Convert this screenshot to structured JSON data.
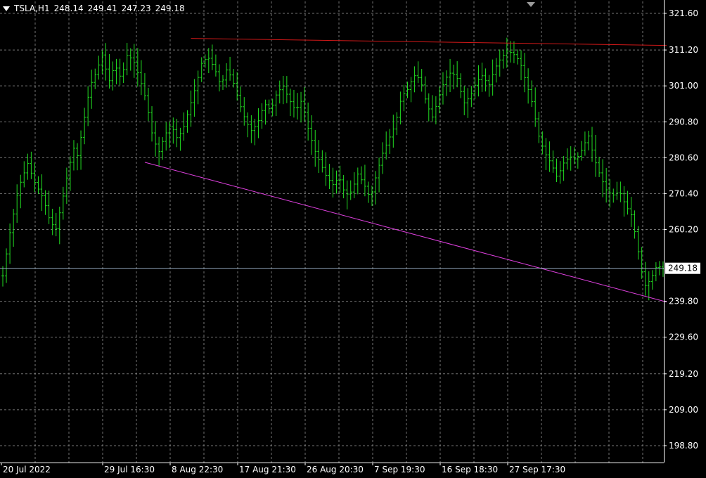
{
  "header": {
    "symbol": "TSLA,H1",
    "open": "248.14",
    "high": "249.41",
    "low": "247.23",
    "close": "249.18"
  },
  "colors": {
    "background": "#000000",
    "grid": "#9a9a9a",
    "bars": "#22dd22",
    "resistance": "#d01818",
    "support": "#e040e0",
    "bid_line": "#8fa3b8"
  },
  "chart_data": {
    "type": "ohlc",
    "symbol": "TSLA",
    "timeframe": "H1",
    "grid": true,
    "ylim": [
      194.0,
      325.0
    ],
    "y_ticks": [
      "321.60",
      "311.20",
      "301.00",
      "290.80",
      "280.60",
      "270.40",
      "260.20",
      "249.18",
      "239.80",
      "229.60",
      "219.20",
      "209.00",
      "198.80"
    ],
    "current_price": 249.18,
    "x_tick_labels": [
      "20 Jul 2022",
      "29 Jul 16:30",
      "8 Aug 22:30",
      "17 Aug 21:30",
      "26 Aug 20:30",
      "7 Sep 19:30",
      "16 Sep 18:30",
      "27 Sep 17:30"
    ],
    "bars_count": 187,
    "close_path": [
      [
        0,
        247
      ],
      [
        2,
        258
      ],
      [
        5,
        272
      ],
      [
        8,
        279
      ],
      [
        10,
        274
      ],
      [
        13,
        269
      ],
      [
        15,
        263
      ],
      [
        17,
        260
      ],
      [
        19,
        268
      ],
      [
        21,
        277
      ],
      [
        23,
        284
      ],
      [
        24,
        281
      ],
      [
        26,
        291
      ],
      [
        28,
        301
      ],
      [
        30,
        305
      ],
      [
        32,
        310
      ],
      [
        34,
        302
      ],
      [
        36,
        307
      ],
      [
        38,
        303
      ],
      [
        40,
        310
      ],
      [
        42,
        308
      ],
      [
        44,
        303
      ],
      [
        46,
        297
      ],
      [
        48,
        287
      ],
      [
        50,
        282
      ],
      [
        52,
        287
      ],
      [
        54,
        290
      ],
      [
        56,
        286
      ],
      [
        58,
        289
      ],
      [
        60,
        295
      ],
      [
        62,
        301
      ],
      [
        64,
        308
      ],
      [
        66,
        309
      ],
      [
        68,
        306
      ],
      [
        70,
        301
      ],
      [
        72,
        306
      ],
      [
        74,
        302
      ],
      [
        76,
        296
      ],
      [
        78,
        291
      ],
      [
        80,
        288
      ],
      [
        82,
        291
      ],
      [
        84,
        296
      ],
      [
        86,
        294
      ],
      [
        88,
        299
      ],
      [
        90,
        301
      ],
      [
        92,
        297
      ],
      [
        94,
        294
      ],
      [
        96,
        297
      ],
      [
        98,
        289
      ],
      [
        100,
        283
      ],
      [
        102,
        279
      ],
      [
        104,
        275
      ],
      [
        106,
        273
      ],
      [
        108,
        275
      ],
      [
        110,
        270
      ],
      [
        112,
        271
      ],
      [
        114,
        276
      ],
      [
        116,
        273
      ],
      [
        118,
        269
      ],
      [
        120,
        276
      ],
      [
        122,
        282
      ],
      [
        124,
        286
      ],
      [
        126,
        290
      ],
      [
        128,
        298
      ],
      [
        130,
        300
      ],
      [
        132,
        304
      ],
      [
        134,
        303
      ],
      [
        136,
        296
      ],
      [
        138,
        292
      ],
      [
        140,
        298
      ],
      [
        142,
        303
      ],
      [
        144,
        305
      ],
      [
        146,
        303
      ],
      [
        148,
        296
      ],
      [
        150,
        298
      ],
      [
        152,
        302
      ],
      [
        154,
        304
      ],
      [
        156,
        301
      ],
      [
        158,
        306
      ],
      [
        160,
        309
      ],
      [
        162,
        311
      ],
      [
        164,
        310
      ],
      [
        166,
        308
      ],
      [
        168,
        302
      ],
      [
        170,
        296
      ],
      [
        172,
        287
      ],
      [
        174,
        282
      ],
      [
        176,
        279
      ],
      [
        178,
        275
      ],
      [
        180,
        279
      ],
      [
        182,
        281
      ],
      [
        184,
        280
      ],
      [
        186,
        283
      ],
      [
        188,
        287
      ],
      [
        190,
        280
      ],
      [
        192,
        275
      ],
      [
        194,
        271
      ],
      [
        196,
        270
      ],
      [
        198,
        271
      ],
      [
        200,
        267
      ],
      [
        202,
        264
      ],
      [
        204,
        254
      ],
      [
        206,
        244
      ],
      [
        208,
        246
      ],
      [
        210,
        250
      ],
      [
        212,
        249
      ]
    ],
    "trendlines": [
      {
        "name": "resistance",
        "x1": 53,
        "y1": 314.5,
        "x2": 187,
        "y2": 312.5
      },
      {
        "name": "support",
        "x1": 40,
        "y1": 279.3,
        "x2": 187,
        "y2": 239.6
      }
    ]
  }
}
